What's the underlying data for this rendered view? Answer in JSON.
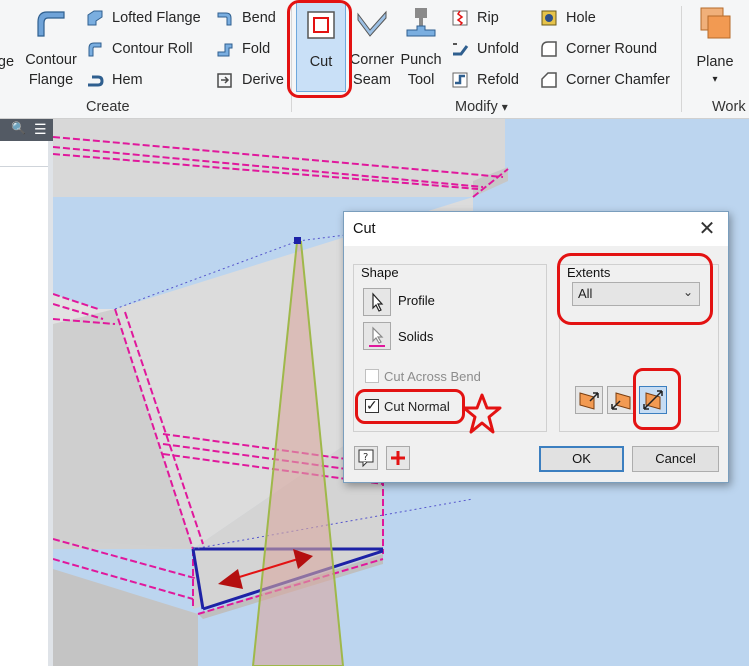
{
  "ribbon": {
    "big_buttons": {
      "flange_partial": "ge",
      "contour_flange": "Contour\nFlange",
      "cut": "Cut",
      "corner_seam": "Corner\nSeam",
      "punch_tool": "Punch\nTool",
      "plane": "Plane"
    },
    "small_buttons": {
      "lofted_flange": "Lofted Flange",
      "contour_roll": "Contour Roll",
      "hem": "Hem",
      "bend": "Bend",
      "fold": "Fold",
      "derive": "Derive",
      "rip": "Rip",
      "unfold": "Unfold",
      "refold": "Refold",
      "hole": "Hole",
      "corner_round": "Corner Round",
      "corner_chamfer": "Corner Chamfer"
    },
    "groups": {
      "create": "Create",
      "modify": "Modify",
      "modify_arrow": "▾",
      "work": "Work"
    }
  },
  "browser": {
    "search_glyph": "🔍",
    "menu_glyph": "☰"
  },
  "dialog": {
    "title": "Cut",
    "close_glyph": "✕",
    "shape": {
      "group_title": "Shape",
      "profile_label": "Profile",
      "solids_label": "Solids",
      "cut_across_bend": "Cut Across Bend",
      "cut_across_bend_checked": false,
      "cut_normal": "Cut Normal",
      "cut_normal_checked": true
    },
    "extents": {
      "group_title": "Extents",
      "selected": "All",
      "chevron": "⌄",
      "direction_buttons": [
        "direction-1",
        "direction-2",
        "symmetric"
      ],
      "selected_direction": 2
    },
    "buttons": {
      "ok": "OK",
      "cancel": "Cancel"
    },
    "checkmark": "✓"
  },
  "colors": {
    "highlight_red": "#e31212",
    "edge_magenta": "#e0189c",
    "edge_blue": "#1d22a6",
    "viewport_bg": "#bcd5ef",
    "model_gray": "#d7d7d7",
    "accent_blue": "#3c7fc0"
  }
}
